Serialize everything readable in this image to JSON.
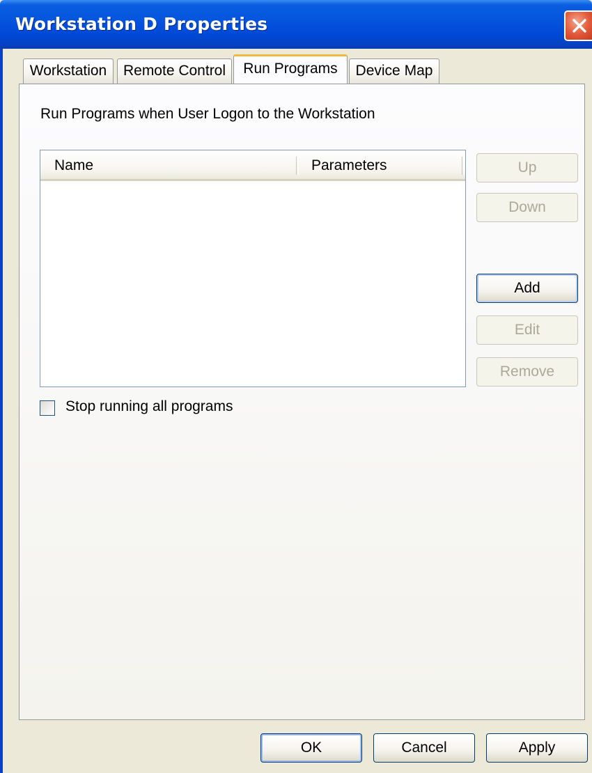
{
  "window": {
    "title": "Workstation D Properties",
    "close_icon": "close-icon"
  },
  "tabs": [
    {
      "label": "Workstation",
      "active": false
    },
    {
      "label": "Remote Control",
      "active": false
    },
    {
      "label": "Run Programs",
      "active": true
    },
    {
      "label": "Device Map",
      "active": false
    }
  ],
  "run_programs": {
    "heading": "Run Programs when User Logon to the Workstation",
    "list": {
      "columns": [
        "Name",
        "Parameters"
      ],
      "rows": []
    },
    "buttons": {
      "up": {
        "label": "Up",
        "enabled": false
      },
      "down": {
        "label": "Down",
        "enabled": false
      },
      "add": {
        "label": "Add",
        "enabled": true
      },
      "edit": {
        "label": "Edit",
        "enabled": false
      },
      "remove": {
        "label": "Remove",
        "enabled": false
      }
    },
    "stop_all": {
      "label": "Stop running all programs",
      "checked": false
    }
  },
  "dialog_buttons": {
    "ok": "OK",
    "cancel": "Cancel",
    "apply": "Apply"
  },
  "colors": {
    "titlebar": "#0453dd",
    "active_tab_accent": "#f4b83d",
    "close_button": "#e35b3b",
    "face": "#ece9d8",
    "disabled_text": "#aca899"
  }
}
